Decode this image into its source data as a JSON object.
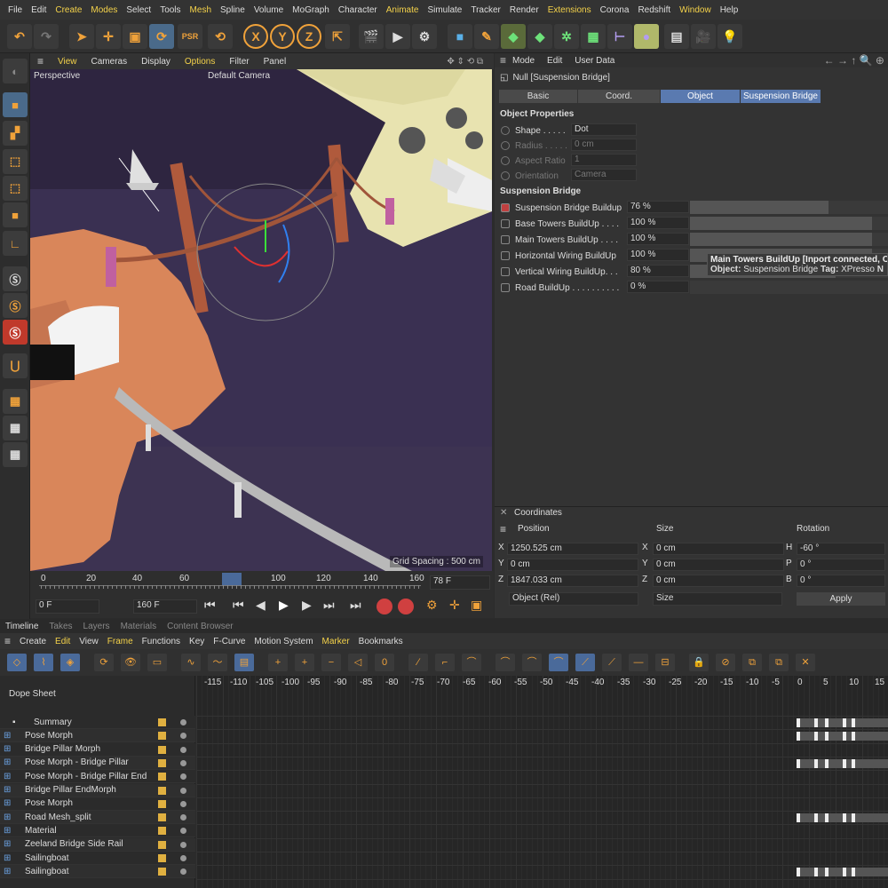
{
  "menubar": {
    "items": [
      "File",
      "Edit",
      "Create",
      "Modes",
      "Select",
      "Tools",
      "Mesh",
      "Spline",
      "Volume",
      "MoGraph",
      "Character",
      "Animate",
      "Simulate",
      "Tracker",
      "Render",
      "Extensions",
      "Corona",
      "Redshift",
      "Window",
      "Help"
    ],
    "highlight": [
      "Create",
      "Modes",
      "Mesh",
      "Animate",
      "Extensions",
      "Window"
    ]
  },
  "viewport": {
    "menu": [
      "View",
      "Cameras",
      "Display",
      "Options",
      "Filter",
      "Panel"
    ],
    "label": "Perspective",
    "camera": "Default Camera",
    "grid_spacing": "Grid Spacing : 500 cm"
  },
  "timeslider": {
    "ticks": [
      "0",
      "20",
      "40",
      "60",
      "78",
      "100",
      "120",
      "140",
      "160"
    ],
    "current_frame": "78 F"
  },
  "transport": {
    "start": "0 F",
    "end": "160 F"
  },
  "attr": {
    "menu": [
      "Mode",
      "Edit",
      "User Data"
    ],
    "title": "Null [Suspension Bridge]",
    "tabs": [
      "Basic",
      "Coord.",
      "Object",
      "Suspension Bridge"
    ],
    "object_props_header": "Object Properties",
    "props": [
      {
        "label": "Shape . . . . .",
        "value": "Dot"
      },
      {
        "label": "Radius . . . . .",
        "value": "0 cm"
      },
      {
        "label": "Aspect Ratio",
        "value": "1"
      },
      {
        "label": "Orientation",
        "value": "Camera"
      }
    ],
    "bridge_header": "Suspension Bridge",
    "bridge": [
      {
        "label": "Suspension Bridge Buildup",
        "value": "76 %",
        "fill": 0.76
      },
      {
        "label": "Base Towers BuildUp . . . .",
        "value": "100 %",
        "fill": 1.0
      },
      {
        "label": "Main Towers BuildUp . . . .",
        "value": "100 %",
        "fill": 1.0
      },
      {
        "label": "Horizontal Wiring BuildUp",
        "value": "100 %",
        "fill": 1.0
      },
      {
        "label": "Vertical Wiring BuildUp. . .",
        "value": "80 %",
        "fill": 0.8
      },
      {
        "label": "Road BuildUp . . . . . . . . . .",
        "value": "0 %",
        "fill": 0.0
      }
    ],
    "tooltip_line1": "Main Towers BuildUp [Inport connected, O",
    "tooltip_line2_prefix": "Object:",
    "tooltip_obj": "Suspension Bridge",
    "tooltip_tag_prefix": "Tag:",
    "tooltip_tag": "XPresso",
    "tooltip_tail": "N"
  },
  "coords": {
    "title": "Coordinates",
    "headers": [
      "Position",
      "Size",
      "Rotation"
    ],
    "rows": [
      {
        "axis": "X",
        "pos": "1250.525 cm",
        "saxis": "X",
        "size": "0 cm",
        "raxis": "H",
        "rot": "-60 °"
      },
      {
        "axis": "Y",
        "pos": "0 cm",
        "saxis": "Y",
        "size": "0 cm",
        "raxis": "P",
        "rot": "0 °"
      },
      {
        "axis": "Z",
        "pos": "1847.033 cm",
        "saxis": "Z",
        "size": "0 cm",
        "raxis": "B",
        "rot": "0 °"
      }
    ],
    "mode": "Object (Rel)",
    "size_mode": "Size",
    "apply": "Apply"
  },
  "timeline": {
    "tabs": [
      "Timeline",
      "Takes",
      "Layers",
      "Materials",
      "Content Browser"
    ],
    "menu": [
      "Create",
      "Edit",
      "View",
      "Frame",
      "Functions",
      "Key",
      "F-Curve",
      "Motion System",
      "Marker",
      "Bookmarks"
    ],
    "menu_highlight": [
      "Edit",
      "Frame",
      "Marker"
    ],
    "dope_sheet": "Dope Sheet",
    "ruler": [
      "-115",
      "-110",
      "-105",
      "-100",
      "-95",
      "-90",
      "-85",
      "-80",
      "-75",
      "-70",
      "-65",
      "-60",
      "-55",
      "-50",
      "-45",
      "-40",
      "-35",
      "-30",
      "-25",
      "-20",
      "-15",
      "-10",
      "-5",
      "0",
      "5",
      "10",
      "15"
    ],
    "tracks": [
      "Summary",
      "Pose Morph",
      "Bridge Pillar Morph",
      "Pose Morph - Bridge Pillar",
      "Pose Morph - Bridge Pillar End",
      "Bridge Pillar EndMorph",
      "Pose Morph",
      "Road Mesh_split",
      "Material",
      "Zeeland Bridge Side Rail",
      "Sailingboat",
      "Sailingboat"
    ]
  }
}
